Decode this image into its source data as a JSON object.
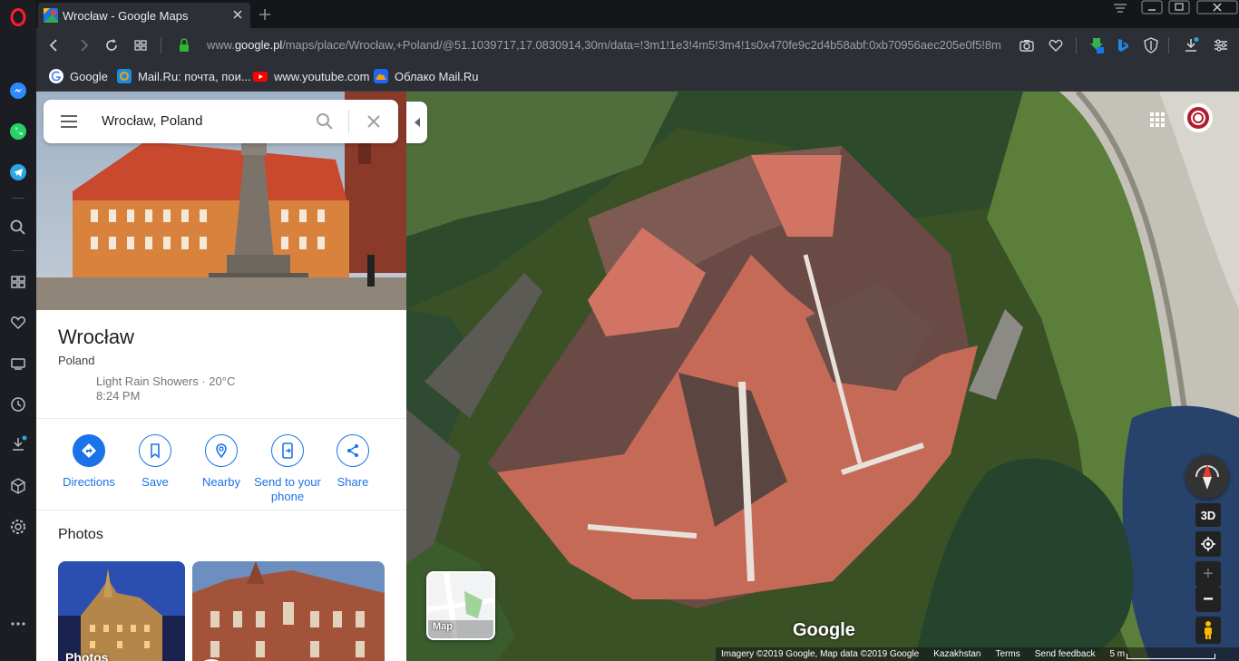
{
  "browser": {
    "tab": {
      "title": "Wrocław - Google Maps",
      "favicon": "google-maps-icon"
    },
    "url_prefix": "www.",
    "url_domain": "google.pl",
    "url_rest": "/maps/place/Wrocław,+Poland/@51.1039717,17.0830914,30m/data=!3m1!1e3!4m5!3m4!1s0x470fe9c2d4b58abf:0xb70956aec205e0f5!8m",
    "bookmarks": [
      {
        "label": "Google",
        "icon": "google-icon"
      },
      {
        "label": "Mail.Ru: почта, пои...",
        "icon": "mailru-icon"
      },
      {
        "label": "www.youtube.com",
        "icon": "youtube-icon"
      },
      {
        "label": "Облако Mail.Ru",
        "icon": "cloud-icon"
      }
    ]
  },
  "search": {
    "value": "Wrocław, Poland"
  },
  "place": {
    "title": "Wrocław",
    "country": "Poland",
    "weather": "Light Rain Showers · 20°C",
    "time": "8:24 PM"
  },
  "actions": [
    {
      "label": "Directions",
      "icon": "directions-icon"
    },
    {
      "label": "Save",
      "icon": "bookmark-icon"
    },
    {
      "label": "Nearby",
      "icon": "nearby-icon"
    },
    {
      "label": "Send to your phone",
      "icon": "send-to-phone-icon"
    },
    {
      "label": "Share",
      "icon": "share-icon"
    }
  ],
  "photos": {
    "heading": "Photos",
    "first_label": "Photos"
  },
  "map": {
    "layer_label": "Map",
    "brand": "Google",
    "footer": {
      "imagery": "Imagery ©2019 Google, Map data ©2019 Google",
      "country": "Kazakhstan",
      "terms": "Terms",
      "feedback": "Send feedback",
      "scale": "5 m"
    },
    "btn_3d": "3D",
    "zoom_in": "+",
    "zoom_out": "−"
  },
  "colors": {
    "accent": "#1a73e8",
    "opera_red": "#ff1b2d"
  }
}
